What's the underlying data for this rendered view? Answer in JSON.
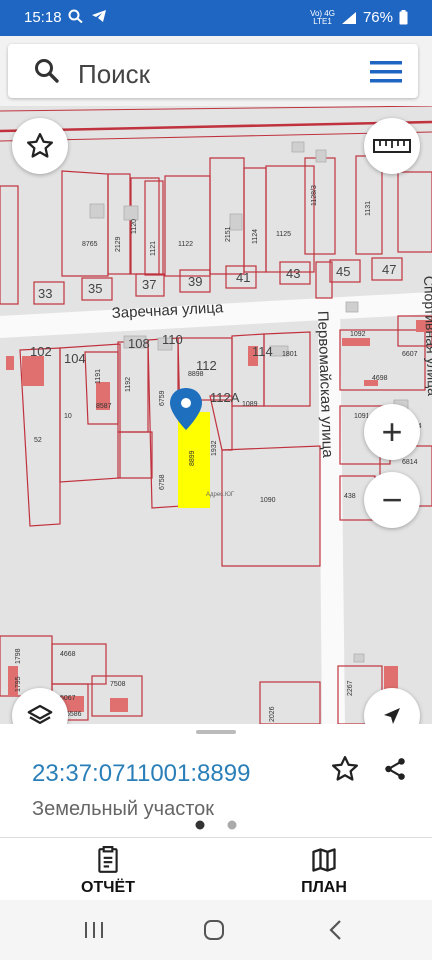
{
  "status_bar": {
    "time": "15:18",
    "network_top": "Vo) 4G",
    "network_bottom": "LTE1",
    "battery": "76%"
  },
  "search": {
    "placeholder": "Поиск",
    "search_icon": "search-icon",
    "menu_icon": "hamburger-menu-icon"
  },
  "map": {
    "street_labels": [
      "Заречная улица",
      "Первомайская улица",
      "Спортивная улица"
    ],
    "house_numbers": [
      "33",
      "35",
      "37",
      "39",
      "41",
      "43",
      "45",
      "47",
      "102",
      "104",
      "108",
      "110",
      "112",
      "112А",
      "114"
    ],
    "parcel_labels": [
      "8765",
      "2129",
      "1120",
      "1121",
      "1122",
      "2151",
      "1124",
      "1125",
      "1128/3",
      "1131",
      "1092",
      "6607",
      "4698",
      "5204",
      "1801",
      "8898",
      "1089",
      "1191",
      "8587",
      "1192",
      "6759",
      "8899",
      "1932",
      "1090",
      "6758",
      "10",
      "52",
      "1091",
      "6814",
      "438",
      "4668",
      "7508",
      "5067",
      "6586",
      "2267",
      "2026",
      "1798",
      "1795"
    ],
    "selected_parcel": "8899",
    "watermark": "Адрес.ЮГ",
    "colors": {
      "background": "#e3e3e3",
      "parcel_border": "#c0323e",
      "selected_fill": "#ffff00",
      "pin": "#1f6fbf",
      "building": "#e07070"
    }
  },
  "controls": {
    "favorite_icon": "star-outline-icon",
    "ruler_icon": "ruler-icon",
    "zoom_in": "+",
    "zoom_out": "−",
    "layers_icon": "layers-icon",
    "locate_icon": "navigation-arrow-icon"
  },
  "sheet": {
    "cadastral_number": "23:37:0711001:8899",
    "object_type": "Земельный участок",
    "star_icon": "star-outline-icon",
    "share_icon": "share-icon",
    "tabs": [
      {
        "label": "ОТЧЁТ",
        "icon": "report-document-icon"
      },
      {
        "label": "ПЛАН",
        "icon": "map-plan-icon"
      }
    ]
  },
  "nav_bar": {
    "recents_icon": "recents-icon",
    "home_icon": "home-icon",
    "back_icon": "back-icon"
  }
}
